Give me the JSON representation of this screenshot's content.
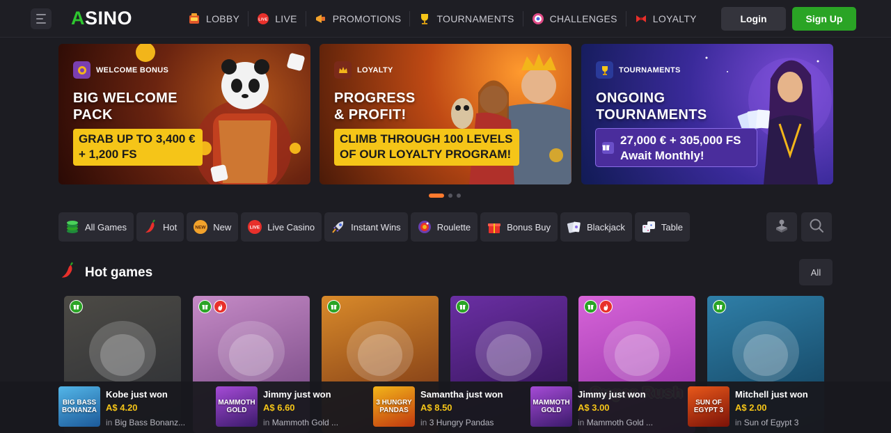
{
  "header": {
    "logo_a": "A",
    "logo_rest": "SINO",
    "nav": [
      {
        "label": "LOBBY",
        "icon": "slot-machine-icon"
      },
      {
        "label": "LIVE",
        "icon": "live-badge-icon"
      },
      {
        "label": "PROMOTIONS",
        "icon": "megaphone-icon"
      },
      {
        "label": "TOURNAMENTS",
        "icon": "trophy-icon"
      },
      {
        "label": "CHALLENGES",
        "icon": "target-icon"
      },
      {
        "label": "LOYALTY",
        "icon": "bow-icon"
      }
    ],
    "login": "Login",
    "signup": "Sign Up"
  },
  "banners": [
    {
      "tag": "WELCOME BONUS",
      "title_1": "BIG WELCOME",
      "title_2": "PACK",
      "offer_1": "GRAB UP TO 3,400 €",
      "offer_2": "+ 1,200 FS"
    },
    {
      "tag": "LOYALTY",
      "title_1": "PROGRESS",
      "title_2": "& PROFIT!",
      "offer_1": "CLIMB THROUGH 100 LEVELS",
      "offer_2": "OF OUR LOYALTY PROGRAM!"
    },
    {
      "tag": "TOURNAMENTS",
      "title_1": "ONGOING",
      "title_2": "TOURNAMENTS",
      "offer_1": "27,000 € + 305,000 FS",
      "offer_2": "Await Monthly!"
    }
  ],
  "carousel": {
    "active_index": 0,
    "count": 3
  },
  "categories": [
    {
      "label": "All Games",
      "icon": "chips-icon"
    },
    {
      "label": "Hot",
      "icon": "chili-icon"
    },
    {
      "label": "New",
      "icon": "new-badge-icon",
      "badge": "NEW"
    },
    {
      "label": "Live Casino",
      "icon": "live-badge-icon",
      "badge": "LIVE"
    },
    {
      "label": "Instant Wins",
      "icon": "rocket-icon"
    },
    {
      "label": "Roulette",
      "icon": "roulette-icon"
    },
    {
      "label": "Bonus Buy",
      "icon": "gift-box-icon"
    },
    {
      "label": "Blackjack",
      "icon": "cards-icon"
    },
    {
      "label": "Table",
      "icon": "dice-icon"
    }
  ],
  "section": {
    "title": "Hot games",
    "all": "All"
  },
  "games": [
    {
      "name": "",
      "badges": [
        "gift"
      ],
      "colors": [
        "#4c4a45",
        "#2a2d33"
      ]
    },
    {
      "name": "",
      "badges": [
        "gift",
        "hot"
      ],
      "colors": [
        "#c58ac6",
        "#6b3f7a"
      ]
    },
    {
      "name": "",
      "badges": [
        "gift"
      ],
      "colors": [
        "#d98a2a",
        "#6b2a12"
      ]
    },
    {
      "name": "",
      "badges": [
        "gift"
      ],
      "colors": [
        "#6a2fa3",
        "#2a0f4a"
      ]
    },
    {
      "name": "Sugar Rush",
      "badges": [
        "gift",
        "hot"
      ],
      "colors": [
        "#d764d8",
        "#8a2aa0"
      ]
    },
    {
      "name": "",
      "badges": [
        "gift"
      ],
      "colors": [
        "#2f7fa8",
        "#0f3a55"
      ]
    }
  ],
  "winners": [
    {
      "name": "Kobe just won",
      "amount": "A$ 4.20",
      "prefix": "in",
      "game": "Big Bass Bonanz...",
      "thumb_label": "BIG BASS BONANZA",
      "thumb_colors": [
        "#53b6e8",
        "#1c5a9a"
      ]
    },
    {
      "name": "Jimmy just won",
      "amount": "A$ 6.60",
      "prefix": "in",
      "game": "Mammoth Gold ...",
      "thumb_label": "MAMMOTH GOLD",
      "thumb_colors": [
        "#a54bd6",
        "#3b1a6b"
      ]
    },
    {
      "name": "Samantha just won",
      "amount": "A$ 8.50",
      "prefix": "in",
      "game": "3 Hungry Pandas",
      "thumb_label": "3 HUNGRY PANDAS",
      "thumb_colors": [
        "#f2b51a",
        "#c1380f"
      ]
    },
    {
      "name": "Jimmy just won",
      "amount": "A$ 3.00",
      "prefix": "in",
      "game": "Mammoth Gold ...",
      "thumb_label": "MAMMOTH GOLD",
      "thumb_colors": [
        "#a54bd6",
        "#3b1a6b"
      ]
    },
    {
      "name": "Mitchell just won",
      "amount": "A$ 2.00",
      "prefix": "in",
      "game": "Sun of Egypt 3",
      "thumb_label": "SUN OF EGYPT 3",
      "thumb_colors": [
        "#e8581a",
        "#7a1208"
      ]
    }
  ]
}
